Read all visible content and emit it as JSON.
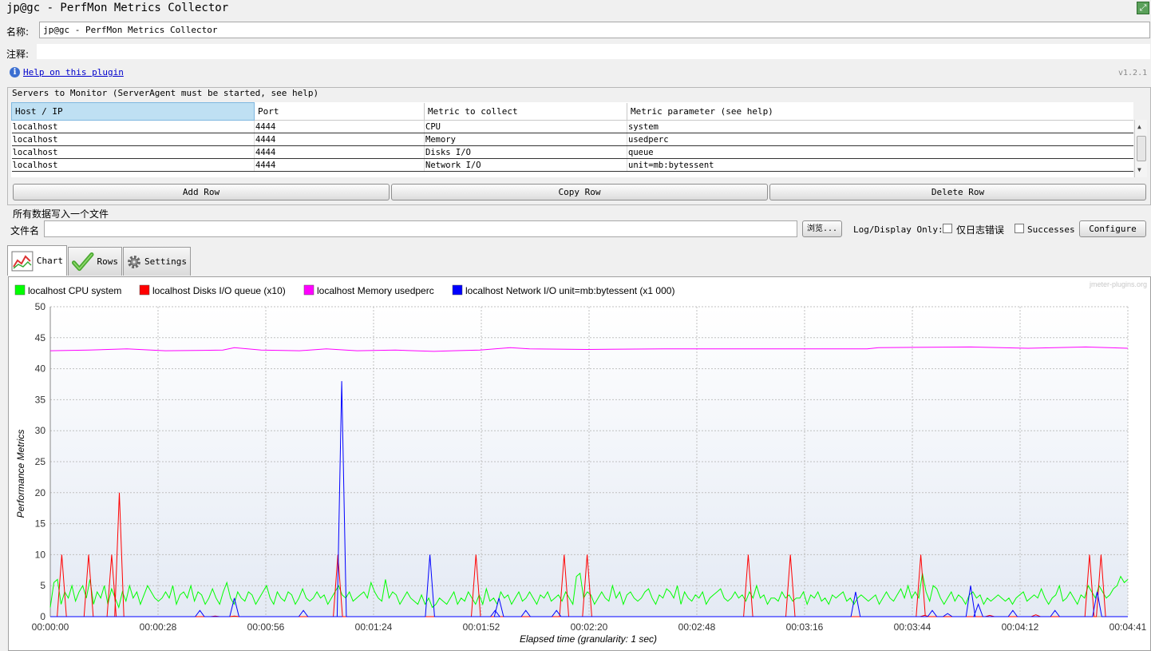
{
  "window": {
    "title": "jp@gc - PerfMon Metrics Collector"
  },
  "form": {
    "name_label": "名称:",
    "name_value": "jp@gc - PerfMon Metrics Collector",
    "comment_label": "注释:",
    "help_link": "Help on this plugin",
    "version": "v1.2.1"
  },
  "servers": {
    "group_label": "Servers to Monitor (ServerAgent must be started, see help)",
    "columns": [
      "Host / IP",
      "Port",
      "Metric to collect",
      "Metric parameter (see help)"
    ],
    "rows": [
      [
        "localhost",
        "4444",
        "CPU",
        "system"
      ],
      [
        "localhost",
        "4444",
        "Memory",
        "usedperc"
      ],
      [
        "localhost",
        "4444",
        "Disks I/O",
        "queue"
      ],
      [
        "localhost",
        "4444",
        "Network I/O",
        "unit=mb:bytessent"
      ]
    ],
    "add_row": "Add Row",
    "copy_row": "Copy Row",
    "delete_row": "Delete Row"
  },
  "file": {
    "group_label": "所有数据写入一个文件",
    "filename_label": "文件名",
    "browse": "浏览...",
    "log_display_only": "Log/Display Only:",
    "errors_only": "仅日志错误",
    "successes": "Successes",
    "configure": "Configure"
  },
  "tabs": [
    {
      "label": "Chart",
      "icon": "chart-icon",
      "active": true
    },
    {
      "label": "Rows",
      "icon": "checkmark-icon",
      "active": false
    },
    {
      "label": "Settings",
      "icon": "gear-icon",
      "active": false
    }
  ],
  "chart_watermark": "jmeter-plugins.org",
  "chart_data": {
    "type": "line",
    "xlabel": "Elapsed time (granularity: 1 sec)",
    "ylabel": "Performance Metrics",
    "ylim": [
      0,
      50
    ],
    "yticks": [
      0,
      5,
      10,
      15,
      20,
      25,
      30,
      35,
      40,
      45,
      50
    ],
    "xticks": [
      "00:00:00",
      "00:00:28",
      "00:00:56",
      "00:01:24",
      "00:01:52",
      "00:02:20",
      "00:02:48",
      "00:03:16",
      "00:03:44",
      "00:04:12",
      "00:04:41"
    ],
    "x_max_seconds": 281,
    "grid": true,
    "legend_position": "top-left",
    "series": [
      {
        "name": "localhost CPU system",
        "color": "#00ff00",
        "values": [
          1.5,
          5.5,
          6,
          2,
          4,
          3,
          5,
          2.5,
          4,
          5,
          3,
          6,
          2,
          4,
          3,
          5,
          2,
          4.5,
          3,
          1.5,
          4,
          2.5,
          5,
          3,
          4,
          2,
          3.5,
          5,
          4,
          3,
          2.5,
          3,
          4,
          3,
          5,
          2,
          3.5,
          4,
          3,
          5,
          2.5,
          4,
          3.5,
          2,
          3,
          4.5,
          3,
          2,
          4,
          5.5,
          3,
          2,
          4,
          3,
          2.5,
          4,
          3.5,
          2,
          3,
          4,
          5,
          3,
          2,
          4,
          3,
          2.5,
          4,
          3.5,
          2,
          3,
          4.5,
          3,
          2.5,
          3,
          4,
          3,
          3.5,
          2,
          3,
          4,
          5,
          3.5,
          3,
          4,
          2.5,
          3,
          3.5,
          4,
          3,
          5.5,
          4,
          3,
          2.5,
          6,
          3,
          4,
          3.5,
          2,
          3,
          4,
          3,
          2.5,
          2,
          3.5,
          2,
          3,
          1.5,
          2,
          3,
          2.5,
          2,
          3,
          4,
          2,
          3,
          2.5,
          4,
          3,
          2,
          3.5,
          2,
          4.5,
          2.5,
          3,
          2,
          4,
          3,
          3.5,
          2,
          3,
          4,
          2.5,
          3,
          4,
          3,
          2,
          3.5,
          3,
          4,
          2.5,
          3,
          3.5,
          2.5,
          4,
          3,
          2,
          6.5,
          7,
          3,
          4,
          3.5,
          2,
          3,
          4,
          3,
          2.5,
          5,
          3,
          4,
          2,
          3.5,
          4,
          3,
          2.5,
          3,
          4,
          4.5,
          3,
          2,
          3.5,
          3,
          4.5,
          4,
          3,
          5,
          2,
          4,
          3,
          2.5,
          3.5,
          3,
          4,
          2,
          3,
          3.5,
          4,
          4.5,
          3,
          2.5,
          3,
          4,
          3,
          3.5,
          2.5,
          4,
          3,
          5,
          3,
          3.5,
          2,
          3,
          3,
          2.5,
          4,
          3,
          3.5,
          2.5,
          3,
          3,
          4,
          2,
          3.5,
          3,
          4,
          2.5,
          3,
          2,
          3.5,
          3,
          3.5,
          4,
          2.5,
          3,
          2,
          3,
          3.5,
          3,
          2.5,
          3,
          3.5,
          2,
          3,
          4,
          3,
          2.5,
          3.5,
          4.5,
          3,
          5,
          3,
          4,
          3,
          7,
          4,
          2.5,
          5,
          4.5,
          3,
          2,
          3,
          4,
          2.5,
          3.5,
          3,
          2,
          3.5,
          4,
          3,
          3.5,
          2,
          3,
          2.5,
          3,
          3.5,
          3,
          2.5,
          3,
          2,
          3,
          3.5,
          4,
          2.5,
          3,
          3.5,
          3,
          4.5,
          3,
          2,
          3,
          3.5,
          5,
          2.5,
          3,
          4,
          3,
          2,
          3.5,
          3,
          5,
          4,
          3,
          5,
          4,
          3,
          3.5,
          4.5,
          5,
          6.5,
          5.5,
          6
        ]
      },
      {
        "name": "localhost Disks I/O queue (x10)",
        "color": "#ff0000",
        "spikes": [
          [
            3,
            10
          ],
          [
            10,
            10
          ],
          [
            16,
            10
          ],
          [
            18,
            20
          ],
          [
            43,
            0.1
          ],
          [
            48,
            0.1
          ],
          [
            75,
            10
          ],
          [
            111,
            10
          ],
          [
            134,
            10
          ],
          [
            140,
            10
          ],
          [
            182,
            10
          ],
          [
            193,
            10
          ],
          [
            227,
            10
          ],
          [
            228,
            0.2
          ],
          [
            245,
            0.2
          ],
          [
            257,
            0.3
          ],
          [
            271,
            10
          ],
          [
            274,
            10
          ]
        ]
      },
      {
        "name": "localhost Memory usedperc",
        "color": "#ff00ff",
        "values": [
          [
            0,
            42.9
          ],
          [
            10,
            43
          ],
          [
            20,
            43.2
          ],
          [
            30,
            42.9
          ],
          [
            45,
            43
          ],
          [
            48,
            43.4
          ],
          [
            55,
            43
          ],
          [
            65,
            42.9
          ],
          [
            72,
            43.2
          ],
          [
            80,
            42.9
          ],
          [
            90,
            43
          ],
          [
            100,
            42.8
          ],
          [
            105,
            42.9
          ],
          [
            112,
            43
          ],
          [
            120,
            43.4
          ],
          [
            125,
            43.2
          ],
          [
            140,
            43.1
          ],
          [
            160,
            43.2
          ],
          [
            200,
            43.2
          ],
          [
            213,
            43.2
          ],
          [
            216,
            43.4
          ],
          [
            240,
            43.5
          ],
          [
            255,
            43.3
          ],
          [
            270,
            43.5
          ],
          [
            281,
            43.3
          ]
        ]
      },
      {
        "name": "localhost Network I/O unit=mb:bytessent (x1 000)",
        "color": "#0000ff",
        "spikes": [
          [
            39,
            1
          ],
          [
            48,
            3
          ],
          [
            66,
            1
          ],
          [
            75,
            0
          ],
          [
            76,
            38
          ],
          [
            99,
            10
          ],
          [
            116,
            1
          ],
          [
            117,
            3
          ],
          [
            124,
            1
          ],
          [
            132,
            1
          ],
          [
            147,
            0
          ],
          [
            210,
            4
          ],
          [
            230,
            1
          ],
          [
            234,
            0.5
          ],
          [
            240,
            5
          ],
          [
            242,
            2
          ],
          [
            251,
            1
          ],
          [
            262,
            1
          ],
          [
            273,
            4
          ]
        ]
      }
    ]
  }
}
